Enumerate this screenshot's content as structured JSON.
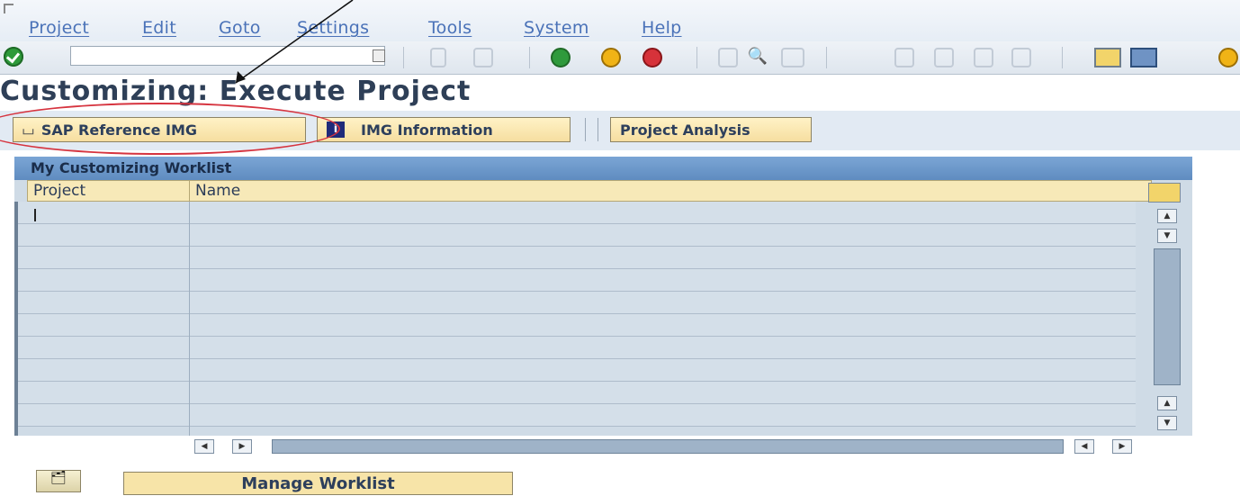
{
  "menu": {
    "items": [
      "Project",
      "Edit",
      "Goto",
      "Settings",
      "Tools",
      "System",
      "Help"
    ]
  },
  "toolbar": {
    "command_field_value": "",
    "icons": [
      "enter-icon",
      "command-dropdown-icon",
      "save-icon",
      "back-icon",
      "exit-icon",
      "cancel-icon",
      "print-icon",
      "find-icon",
      "find-next-icon",
      "first-page-icon",
      "previous-page-icon",
      "next-page-icon",
      "last-page-icon",
      "create-session-icon",
      "shortcut-icon",
      "help-icon"
    ]
  },
  "page": {
    "title": "Customizing: Execute Project"
  },
  "app_toolbar": {
    "sap_reference_img": "SAP Reference IMG",
    "img_information": "IMG Information",
    "project_analysis": "Project Analysis"
  },
  "worklist": {
    "title": "My Customizing Worklist",
    "columns": [
      "Project",
      "Name"
    ],
    "rows": [
      {
        "project": "",
        "name": ""
      },
      {
        "project": "",
        "name": ""
      },
      {
        "project": "",
        "name": ""
      },
      {
        "project": "",
        "name": ""
      },
      {
        "project": "",
        "name": ""
      },
      {
        "project": "",
        "name": ""
      },
      {
        "project": "",
        "name": ""
      },
      {
        "project": "",
        "name": ""
      },
      {
        "project": "",
        "name": ""
      },
      {
        "project": "",
        "name": ""
      }
    ]
  },
  "bottom": {
    "manage_worklist": "Manage Worklist"
  },
  "colors": {
    "highlight_oval": "#d6343f",
    "button_fill": "#f6dea0",
    "header_blue": "#5f8cc0"
  }
}
